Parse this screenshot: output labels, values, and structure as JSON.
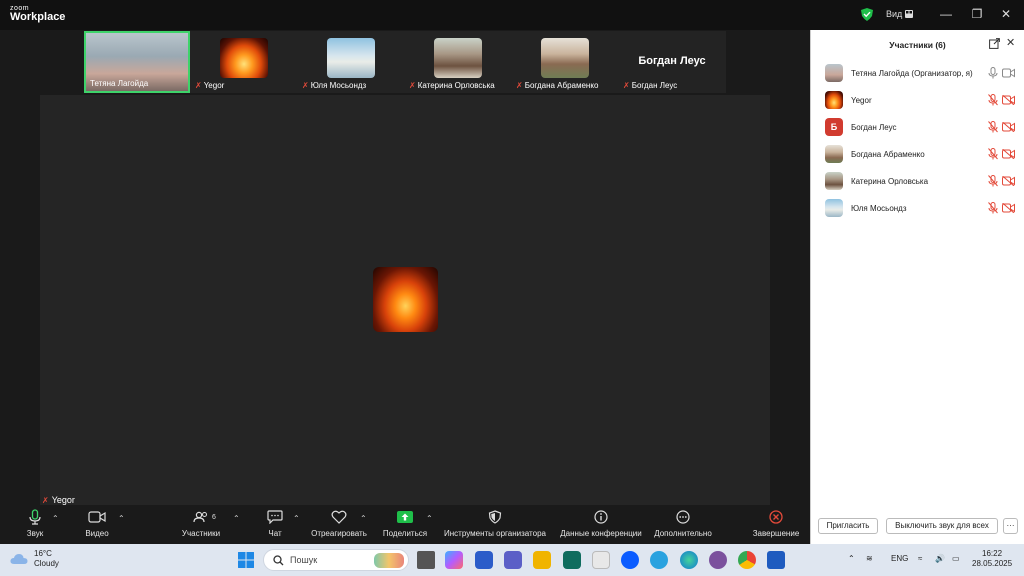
{
  "app": {
    "logo_small": "zoom",
    "logo_big": "Workplace",
    "view_label": "Вид"
  },
  "gallery": [
    {
      "name": "Тетяна Лагойда",
      "muted": false
    },
    {
      "name": "Yegor",
      "muted": true
    },
    {
      "name": "Юля Мосьондз",
      "muted": true
    },
    {
      "name": "Катерина Орловська",
      "muted": true
    },
    {
      "name": "Богдана Абраменко",
      "muted": true
    },
    {
      "name": "Богдан Леус",
      "muted": true,
      "big_name": "Богдан Леус"
    }
  ],
  "stage": {
    "name": "Yegor"
  },
  "toolbar": {
    "audio": "Звук",
    "video": "Видео",
    "participants": "Участники",
    "participants_count": "6",
    "chat": "Чат",
    "react": "Отреагировать",
    "share": "Поделиться",
    "host_tools": "Инструменты организатора",
    "meeting_info": "Данные конференции",
    "more": "Дополнительно",
    "end": "Завершение"
  },
  "panel": {
    "title": "Участники (6)",
    "participants": [
      {
        "name": "Тетяна Лагойда (Организатор, я)"
      },
      {
        "name": "Yegor"
      },
      {
        "name": "Богдан Леус",
        "initial": "Б"
      },
      {
        "name": "Богдана Абраменко"
      },
      {
        "name": "Катерина Орловська"
      },
      {
        "name": "Юля Мосьондз"
      }
    ],
    "invite": "Пригласить",
    "mute_all": "Выключить звук для всех",
    "more": "···"
  },
  "taskbar": {
    "temp": "16°C",
    "weather": "Cloudy",
    "search": "Пошук",
    "lang": "ENG",
    "time": "16:22",
    "date": "28.05.2025"
  },
  "colors": {
    "accent": "#3ed36a",
    "muted_red": "#e34a3a",
    "share_green": "#1fbf4a"
  }
}
